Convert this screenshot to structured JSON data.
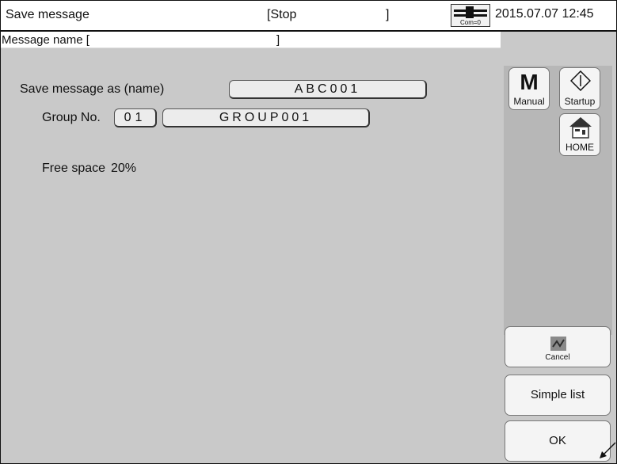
{
  "header": {
    "title": "Save message",
    "status_open": "[Stop",
    "status_close": "]",
    "com_label": "Com=0",
    "datetime": "2015.07.07 12:45"
  },
  "message_bar": {
    "label": "Message name [",
    "close": "]"
  },
  "form": {
    "save_as_label": "Save message as (name)",
    "save_as_value": "ABC001",
    "group_label": "Group No.",
    "group_no_value": "01",
    "group_name_value": "GROUP001",
    "free_space_label": "Free space",
    "free_space_value": "20%"
  },
  "side_buttons": {
    "manual_letter": "M",
    "manual_label": "Manual",
    "startup_label": "Startup",
    "home_label": "HOME",
    "cancel_label": "Cancel",
    "simple_list_label": "Simple list",
    "ok_label": "OK"
  }
}
